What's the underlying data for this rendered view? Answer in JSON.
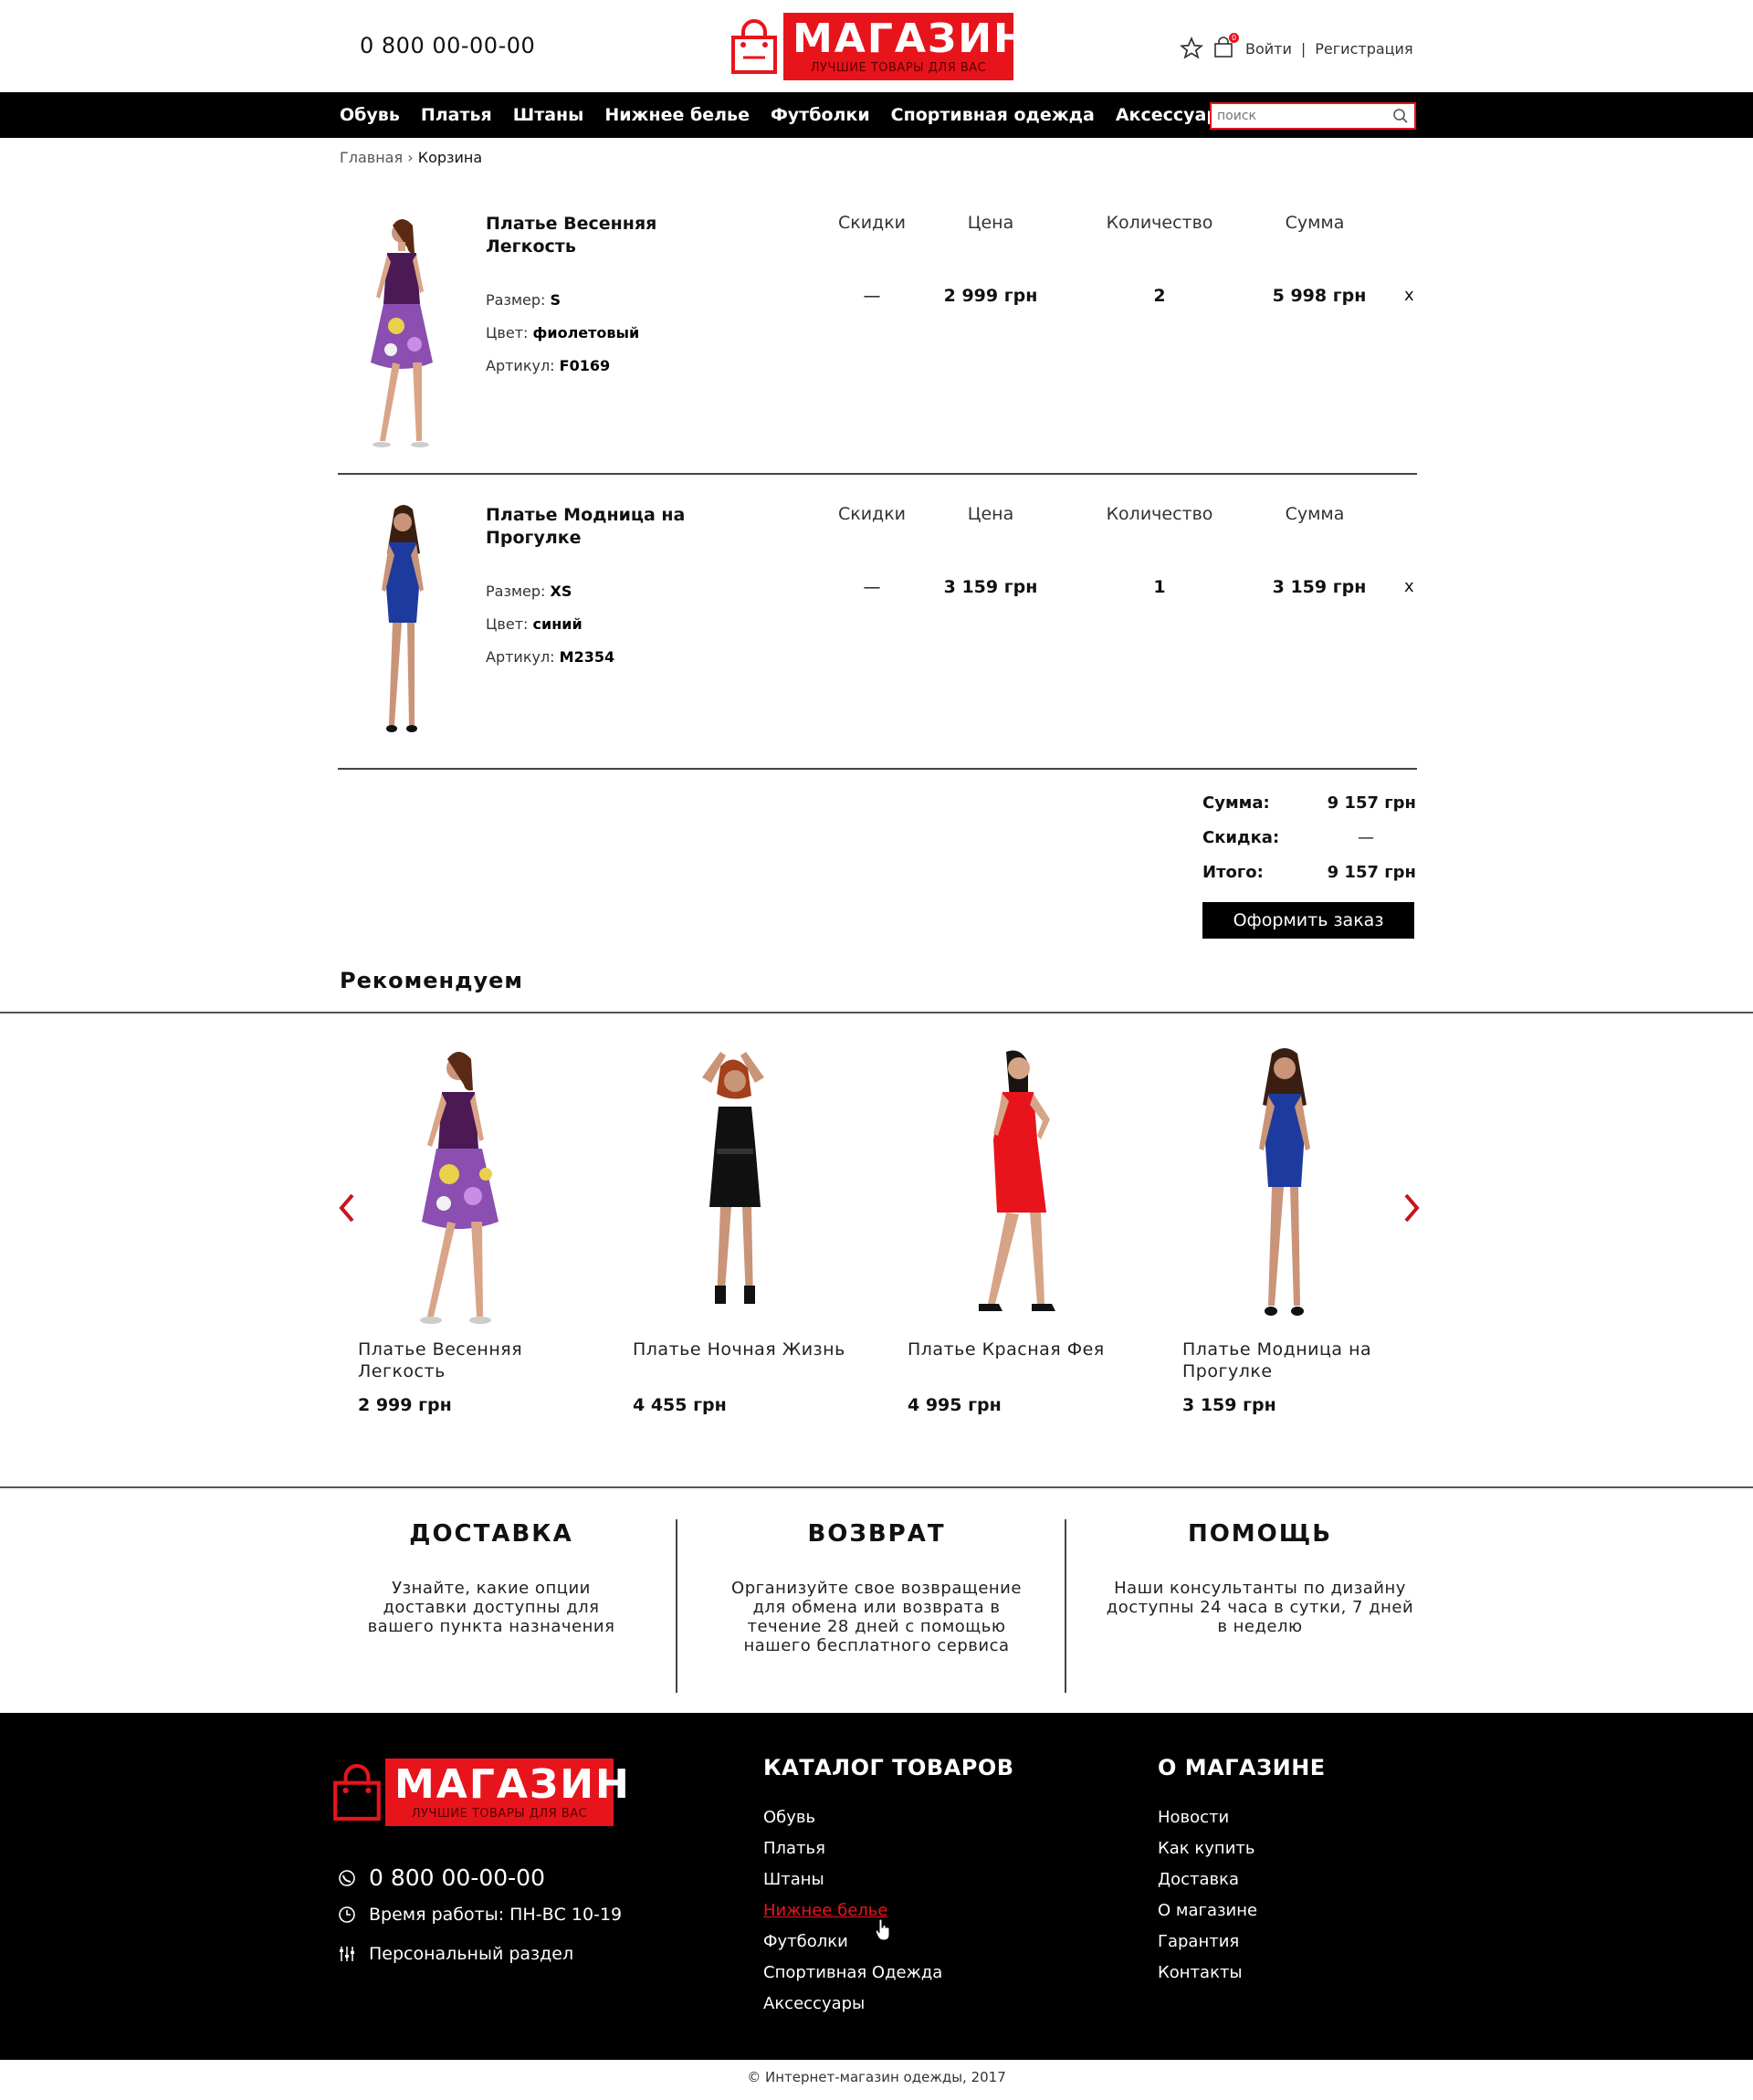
{
  "header": {
    "phone": "0 800 00-00-00",
    "logo_name": "МАГАЗИН",
    "logo_slogan": "ЛУЧШИЕ ТОВАРЫ ДЛЯ ВАС",
    "cart_count": "0",
    "login": "Войти",
    "separator": "|",
    "register": "Регистрация"
  },
  "nav": {
    "items": [
      "Обувь",
      "Платья",
      "Штаны",
      "Нижнее белье",
      "Футболки",
      "Спортивная одежда",
      "Аксессуары"
    ],
    "search_placeholder": "поиск"
  },
  "breadcrumb": {
    "home": "Главная",
    "sep": "›",
    "current": "Корзина"
  },
  "cart": {
    "columns": {
      "discount": "Скидки",
      "price": "Цена",
      "qty": "Количество",
      "sum": "Сумма"
    },
    "remove": "x",
    "attr_labels": {
      "size": "Размер:",
      "color": "Цвет:",
      "sku": "Артикул:"
    },
    "items": [
      {
        "title": "Платье Весенняя Легкость",
        "size": "S",
        "color": "фиолетовый",
        "sku": "F0169",
        "discount": "—",
        "price": "2 999 грн",
        "qty": "2",
        "sum": "5 998 грн"
      },
      {
        "title": "Платье Модница на Прогулке",
        "size": "XS",
        "color": "синий",
        "sku": "M2354",
        "discount": "—",
        "price": "3 159 грн",
        "qty": "1",
        "sum": "3 159 грн"
      }
    ]
  },
  "totals": {
    "sum_label": "Сумма:",
    "sum_value": "9 157 грн",
    "discount_label": "Скидка:",
    "discount_value": "—",
    "total_label": "Итого:",
    "total_value": "9 157 грн",
    "order_button": "Оформить заказ"
  },
  "recommended": {
    "title": "Рекомендуем",
    "items": [
      {
        "name": "Платье Весенняя Легкость",
        "price": "2 999 грн"
      },
      {
        "name": "Платье Ночная Жизнь",
        "price": "4 455 грн"
      },
      {
        "name": "Платье Красная Фея",
        "price": "4 995 грн"
      },
      {
        "name": "Платье Модница на Прогулке",
        "price": "3 159 грн"
      }
    ]
  },
  "info": [
    {
      "title": "ДОСТАВКА",
      "text": "Узнайте, какие опции доставки доступны для вашего пункта назначения"
    },
    {
      "title": "ВОЗВРАТ",
      "text": "Организуйте свое возвращение для обмена или возврата в течение 28 дней с помощью нашего бесплатного сервиса"
    },
    {
      "title": "ПОМОЩЬ",
      "text": "Наши консультанты по дизайну доступны 24 часа в сутки, 7 дней в неделю"
    }
  ],
  "footer": {
    "phone": "0 800 00-00-00",
    "hours": "Время работы: ПН-ВС 10-19",
    "personal": "Персональный раздел",
    "catalog_title": "КАТАЛОГ ТОВАРОВ",
    "catalog": [
      "Обувь",
      "Платья",
      "Штаны",
      "Нижнее белье",
      "Футболки",
      "Спортивная Одежда",
      "Аксессуары"
    ],
    "about_title": "О МАГАЗИНЕ",
    "about": [
      "Новости",
      "Как купить",
      "Доставка",
      "О магазине",
      "Гарантия",
      "Контакты"
    ],
    "copyright": "© Интернет-магазин одежды, 2017"
  },
  "colors": {
    "accent": "#e8141c",
    "dark": "#000000",
    "purple_dress": "#5b1a5e",
    "blue_dress": "#1d3a9e",
    "red_dress": "#e8141c"
  }
}
